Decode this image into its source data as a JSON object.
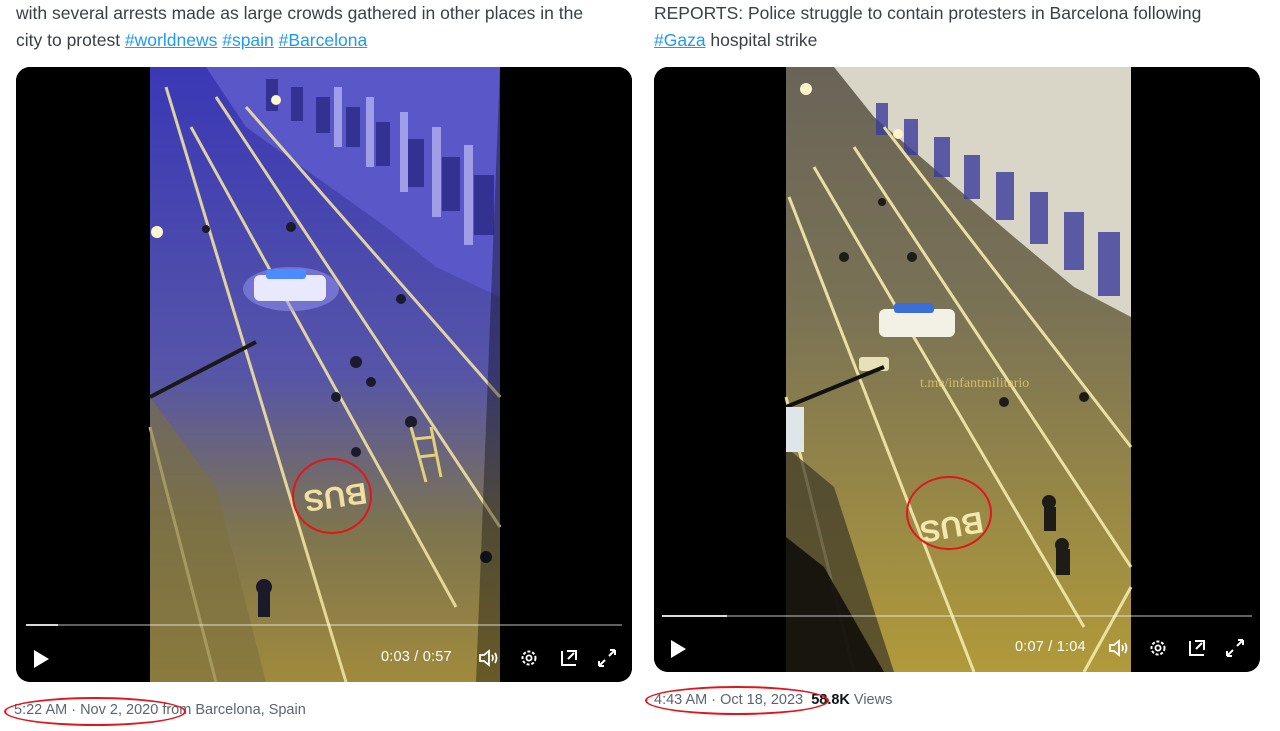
{
  "left_tweet": {
    "line1": "with several arrests made as large crowds gathered in other places in the",
    "line2_prefix": "city to protest ",
    "hashtags": [
      "#worldnews",
      "#spain",
      "#Barcelona"
    ],
    "video": {
      "current_time": "0:03",
      "separator": " / ",
      "duration": "0:57",
      "progress": 0.053,
      "road_marking": "BUS"
    },
    "timestamp": "5:22 AM · Nov 2, 2020",
    "location": "from Barcelona, Spain"
  },
  "right_tweet": {
    "line1": "REPORTS: Police struggle to contain protesters in Barcelona following",
    "hashtag": "#Gaza",
    "line2_suffix": " hospital strike",
    "video": {
      "current_time": "0:07",
      "separator": " / ",
      "duration": "1:04",
      "progress": 0.11,
      "watermark": "t.me/infantmilitario",
      "road_marking": "BUS"
    },
    "timestamp": "4:43 AM · Oct 18, 2023",
    "views_count": "58.8K",
    "views_label": " Views"
  },
  "icons": [
    "play-icon",
    "volume-icon",
    "settings-icon",
    "pip-icon",
    "fullscreen-icon"
  ],
  "colors": {
    "hashtag": "#1d9bf0",
    "annotation": "#e0161c"
  }
}
